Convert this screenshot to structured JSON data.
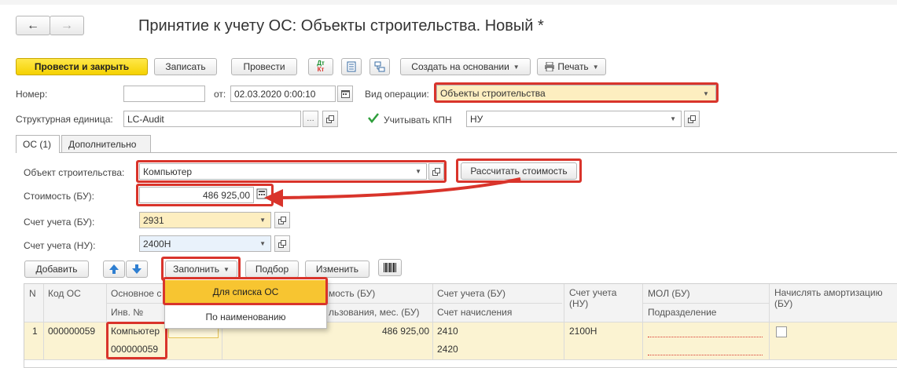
{
  "nav": {
    "back": "←",
    "forward": "→"
  },
  "title": "Принятие к учету ОС: Объекты строительства. Новый *",
  "toolbar": {
    "post_close": "Провести и закрыть",
    "save": "Записать",
    "post": "Провести",
    "dtkt": "Дт Кт",
    "create_based": "Создать на основании",
    "print": "Печать"
  },
  "header": {
    "number_label": "Номер:",
    "number_value": "",
    "date_label": "от:",
    "date_value": "02.03.2020  0:00:10",
    "op_label": "Вид операции:",
    "op_value": "Объекты строительства",
    "unit_label": "Структурная единица:",
    "unit_value": "LC-Audit",
    "kpn_label": "Учитывать КПН",
    "kpn_value": "НУ"
  },
  "tabs": [
    "ОС (1)",
    "Дополнительно"
  ],
  "form": {
    "object_label": "Объект строительства:",
    "object_value": "Компьютер",
    "calc_button": "Рассчитать стоимость",
    "cost_label": "Стоимость (БУ):",
    "cost_value": "486 925,00",
    "account_bu_label": "Счет учета (БУ):",
    "account_bu_value": "2931",
    "account_nu_label": "Счет учета (НУ):",
    "account_nu_value": "2400Н"
  },
  "table_toolbar": {
    "add": "Добавить",
    "fill": "Заполнить",
    "select": "Подбор",
    "change": "Изменить"
  },
  "fill_menu": [
    "Для списка ОС",
    "По наименованию"
  ],
  "table": {
    "headers": {
      "n": "N",
      "code": "Код ОС",
      "main": "Основное с",
      "inv": "Инв. №",
      "cost": "мость (БУ)",
      "term": "льзования, мес. (БУ)",
      "acc_bu": "Счет учета (БУ)",
      "acc_charge": "Счет начисления",
      "acc_nu": "Счет учета (НУ)",
      "mol": "МОЛ (БУ)",
      "dept": "Подразделение",
      "amort": "Начислять амортизацию (БУ)"
    },
    "rows": [
      {
        "n": "1",
        "code": "000000059",
        "name": "Компьютер",
        "inv": "000000059",
        "cost": "486 925,00",
        "acc_bu": "2410",
        "acc_charge": "2420",
        "acc_nu": "2100Н"
      }
    ]
  },
  "colors": {
    "accent_yellow": "#f5d100",
    "highlight": "#d9342b",
    "menu_active": "#f7c531"
  }
}
